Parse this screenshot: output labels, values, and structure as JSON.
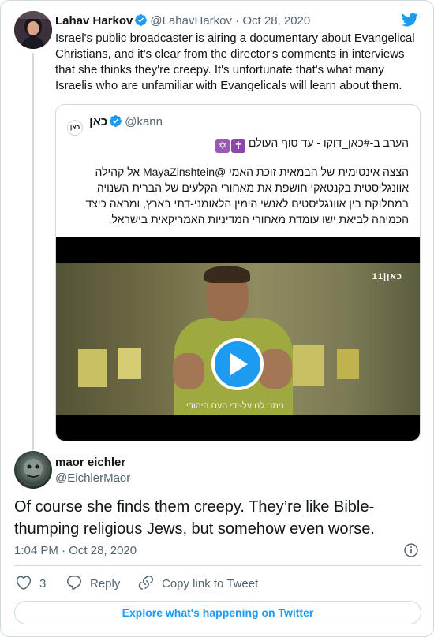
{
  "parent_tweet": {
    "display_name": "Lahav Harkov",
    "handle": "@LahavHarkov",
    "separator": "·",
    "date": "Oct 28, 2020",
    "text": "Israel's public broadcaster is airing a documentary about Evangelical Christians, and it's clear from the director's comments in interviews that she thinks they're creepy. It's unfortunate that's what many Israelis who are unfamiliar with Evangelicals will learn about them."
  },
  "quoted_tweet": {
    "display_name": "כאן",
    "logo_text": "כאן",
    "handle": "@kann",
    "line1": "הערב ב-#כאן_דוקו - עד סוף העולם",
    "emoji": [
      "star-of-david-icon",
      "latin-cross-icon"
    ],
    "body": "הצצה אינטימית של הבמאית זוכת האמי @MayaZinshtein אל קהילה אוונגליסטית בקנטאקי חושפת את מאחורי הקלעים של הברית השנויה במחלוקת בין אוונגליסטים לאנשי הימין הלאומני-דתי בארץ, ומראה כיצד הכמיהה לביאת ישו עומדת מאחורי המדיניות האמריקאית בישראל.",
    "video": {
      "watermark": "כאן|11",
      "subtitle": "ניתנו לנו על-ידי העם היהודי"
    }
  },
  "reply_tweet": {
    "display_name": "maor eichler",
    "handle": "@EichlerMaor",
    "text": "Of course she finds them creepy. They’re like Bible-thumping religious Jews, but somehow even worse.",
    "time": "1:04 PM",
    "separator": "·",
    "date": "Oct 28, 2020"
  },
  "actions": {
    "like_count": "3",
    "reply_label": "Reply",
    "copy_link_label": "Copy link to Tweet"
  },
  "footer": {
    "explore_label": "Explore what's happening on Twitter"
  },
  "colors": {
    "twitter_blue": "#1d9bf0",
    "text_primary": "#0f1419",
    "text_secondary": "#536471",
    "border": "#cfd9de"
  }
}
